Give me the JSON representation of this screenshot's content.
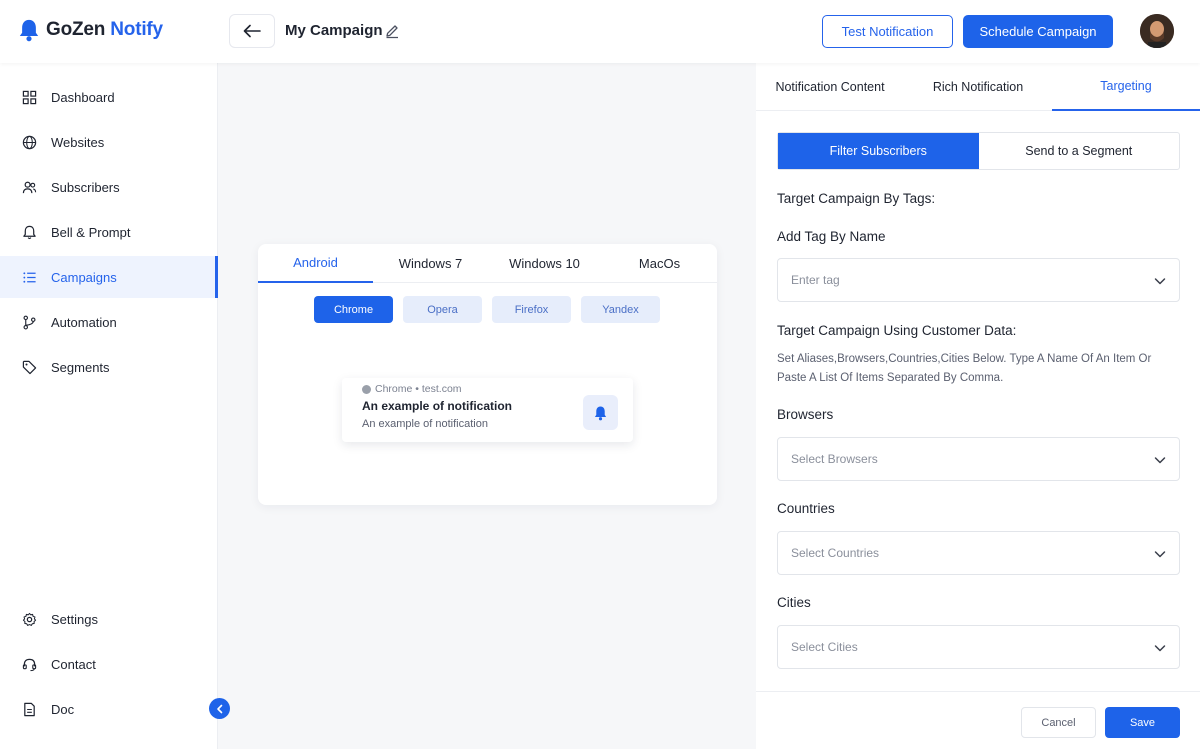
{
  "app": {
    "logo_part1": "GoZen",
    "logo_part2": "Notify"
  },
  "header": {
    "campaign_title": "My Campaign",
    "test_button": "Test Notification",
    "schedule_button": "Schedule Campaign"
  },
  "sidebar": {
    "items": [
      {
        "label": "Dashboard",
        "icon": "dashboard-icon"
      },
      {
        "label": "Websites",
        "icon": "globe-icon"
      },
      {
        "label": "Subscribers",
        "icon": "users-icon"
      },
      {
        "label": "Bell & Prompt",
        "icon": "bell-icon"
      },
      {
        "label": "Campaigns",
        "icon": "list-icon",
        "active": true
      },
      {
        "label": "Automation",
        "icon": "branch-icon"
      },
      {
        "label": "Segments",
        "icon": "tag-icon"
      }
    ],
    "bottom_items": [
      {
        "label": "Settings",
        "icon": "gear-icon"
      },
      {
        "label": "Contact",
        "icon": "headset-icon"
      },
      {
        "label": "Doc",
        "icon": "document-icon"
      }
    ]
  },
  "preview": {
    "os_tabs": [
      "Android",
      "Windows 7",
      "Windows 10",
      "MacOs"
    ],
    "active_os": "Android",
    "browsers": [
      "Chrome",
      "Opera",
      "Firefox",
      "Yandex"
    ],
    "active_browser": "Chrome",
    "notification": {
      "source": "Chrome • test.com",
      "title": "An example of notification",
      "body": "An example of notification"
    }
  },
  "panel": {
    "tabs": [
      "Notification Content",
      "Rich Notification",
      "Targeting"
    ],
    "active_tab": "Targeting",
    "segments": [
      "Filter Subscribers",
      "Send to a Segment"
    ],
    "active_segment": "Filter Subscribers",
    "tags_heading": "Target Campaign By Tags:",
    "add_tag_label": "Add Tag By Name",
    "tag_placeholder": "Enter tag",
    "customer_heading": "Target Campaign Using Customer Data:",
    "customer_help": "Set Aliases,Browsers,Countries,Cities Below. Type A Name Of An Item Or Paste A List Of Items Separated By Comma.",
    "browsers_label": "Browsers",
    "browsers_placeholder": "Select Browsers",
    "countries_label": "Countries",
    "countries_placeholder": "Select Countries",
    "cities_label": "Cities",
    "cities_placeholder": "Select Cities",
    "cancel_button": "Cancel",
    "save_button": "Save"
  },
  "colors": {
    "accent": "#1e63e9",
    "active_bg": "#eef3fe",
    "text": "#1f2430"
  }
}
